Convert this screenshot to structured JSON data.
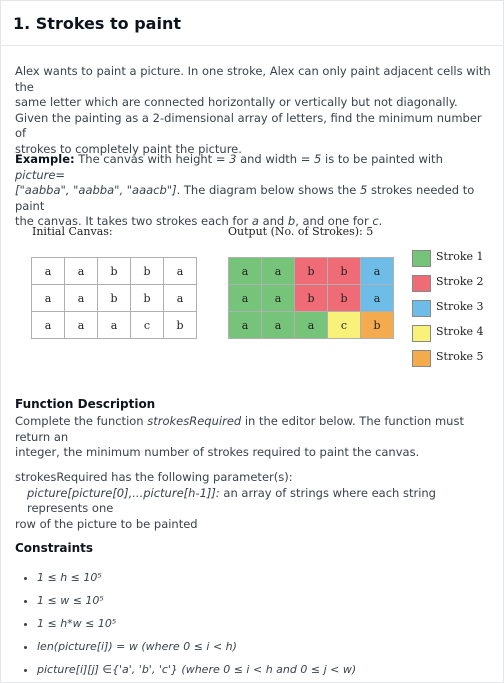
{
  "title": "1. Strokes to paint",
  "intro": {
    "line1": "Alex wants to paint a picture. In one stroke, Alex can only paint adjacent cells with the",
    "line2": "same letter which are connected horizontally or vertically but not diagonally.",
    "line3": "Given the painting as a 2-dimensional array of letters, find the minimum number of",
    "line4": "strokes to completely paint the picture."
  },
  "example": {
    "label": "Example:",
    "text_a": " The canvas with height = ",
    "height": "3",
    "text_b": " and width = ",
    "width": "5",
    "text_c": " is to be painted with ",
    "picture_word": "picture",
    "text_d": "=",
    "array": "[\"aabba\", \"aabba\", \"aaacb\"]",
    "text_e": ". The diagram below shows the ",
    "strokes_count": "5",
    "text_f": " strokes needed to paint",
    "text_g": "the canvas. It takes two strokes each for ",
    "a": "a",
    "and": " and ",
    "b": "b",
    "text_h": ", and one for ",
    "c": "c",
    "period": "."
  },
  "diagram": {
    "initial_label": "Initial Canvas:",
    "output_label": "Output (No. of Strokes): 5",
    "initial_grid": [
      [
        "a",
        "a",
        "b",
        "b",
        "a"
      ],
      [
        "a",
        "a",
        "b",
        "b",
        "a"
      ],
      [
        "a",
        "a",
        "a",
        "c",
        "b"
      ]
    ],
    "output_grid": [
      [
        "a",
        "a",
        "b",
        "b",
        "a"
      ],
      [
        "a",
        "a",
        "b",
        "b",
        "a"
      ],
      [
        "a",
        "a",
        "a",
        "c",
        "b"
      ]
    ],
    "output_colors": [
      [
        "#76c47a",
        "#76c47a",
        "#ef6b75",
        "#ef6b75",
        "#6dbde8"
      ],
      [
        "#76c47a",
        "#76c47a",
        "#ef6b75",
        "#ef6b75",
        "#6dbde8"
      ],
      [
        "#76c47a",
        "#76c47a",
        "#76c47a",
        "#f8f27a",
        "#f4ab4e"
      ]
    ],
    "legend": [
      {
        "label": "Stroke 1",
        "color": "#76c47a"
      },
      {
        "label": "Stroke 2",
        "color": "#ef6b75"
      },
      {
        "label": "Stroke 3",
        "color": "#6dbde8"
      },
      {
        "label": "Stroke 4",
        "color": "#f8f27a"
      },
      {
        "label": "Stroke 5",
        "color": "#f4ab4e"
      }
    ]
  },
  "function_description": {
    "heading": "Function Description",
    "line1_a": "Complete the function ",
    "fn_name": "strokesRequired",
    "line1_b": " in the editor below. The function must return an",
    "line2": "integer, the minimum number of strokes required to paint the canvas."
  },
  "parameters": {
    "intro": "strokesRequired has the following parameter(s):",
    "param_name": "picture[picture[0],...picture[h-1]]:",
    "param_desc_1": "  an array of strings where each string represents one",
    "param_desc_2": "row of the picture to be painted"
  },
  "constraints": {
    "heading": "Constraints",
    "items": [
      "1 ≤ h ≤ 10⁵",
      "1 ≤ w ≤ 10⁵",
      "1 ≤ h*w ≤ 10⁵",
      "len(picture[i]) = w (where 0 ≤ i < h)",
      "picture[i][j] ∈{'a', 'b', 'c'} (where 0 ≤ i < h and 0 ≤ j < w)"
    ]
  }
}
